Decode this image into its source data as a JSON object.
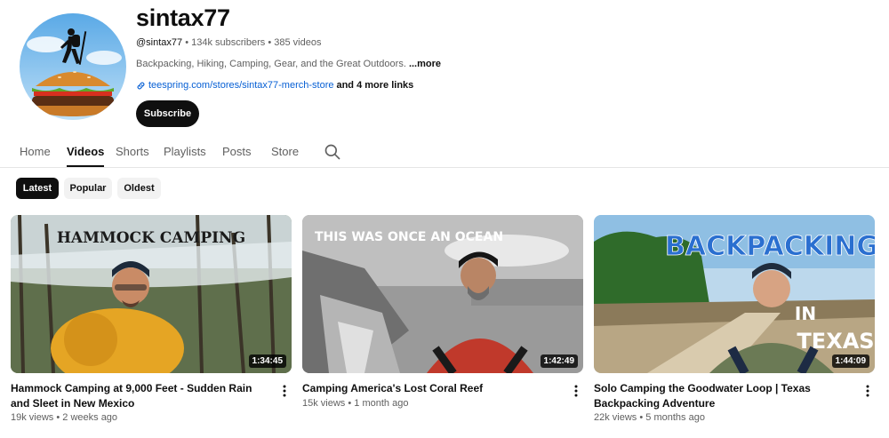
{
  "channel": {
    "name": "sintax77",
    "handle": "@sintax77",
    "subscribers": "134k subscribers",
    "videos_count": "385 videos",
    "separator": "•",
    "description": "Backpacking, Hiking, Camping, Gear, and the Great Outdoors. ",
    "more_label": "...more",
    "link_text": "teespring.com/stores/sintax77-merch-store",
    "more_links": "and 4 more links",
    "subscribe_label": "Subscribe"
  },
  "tabs": [
    {
      "label": "Home"
    },
    {
      "label": "Videos",
      "active": true
    },
    {
      "label": "Shorts"
    },
    {
      "label": "Playlists"
    },
    {
      "label": "Posts"
    },
    {
      "label": "Store"
    }
  ],
  "chips": [
    {
      "label": "Latest",
      "active": true
    },
    {
      "label": "Popular"
    },
    {
      "label": "Oldest"
    }
  ],
  "videos": [
    {
      "thumb_text": "HAMMOCK CAMPING",
      "duration": "1:34:45",
      "title": "Hammock Camping at 9,000 Feet - Sudden Rain and Sleet in New Mexico",
      "views": "19k views",
      "age": "2 weeks ago"
    },
    {
      "thumb_text": "THIS WAS ONCE AN OCEAN",
      "duration": "1:42:49",
      "title": "Camping America's Lost Coral Reef",
      "views": "15k views",
      "age": "1 month ago"
    },
    {
      "thumb_text": "BACKPACKING",
      "thumb_text_2": "IN",
      "thumb_text_3": "TEXAS",
      "duration": "1:44:09",
      "title": "Solo Camping the Goodwater Loop | Texas Backpacking Adventure",
      "views": "22k views",
      "age": "5 months ago"
    }
  ],
  "icons": {
    "search": "search-icon",
    "link": "link-icon",
    "more": "more-vert-icon"
  },
  "colors": {
    "link": "#065fd4",
    "text": "#0f0f0f",
    "secondary": "#606060",
    "chip_active": "#0f0f0f",
    "chip": "#f2f2f2"
  }
}
